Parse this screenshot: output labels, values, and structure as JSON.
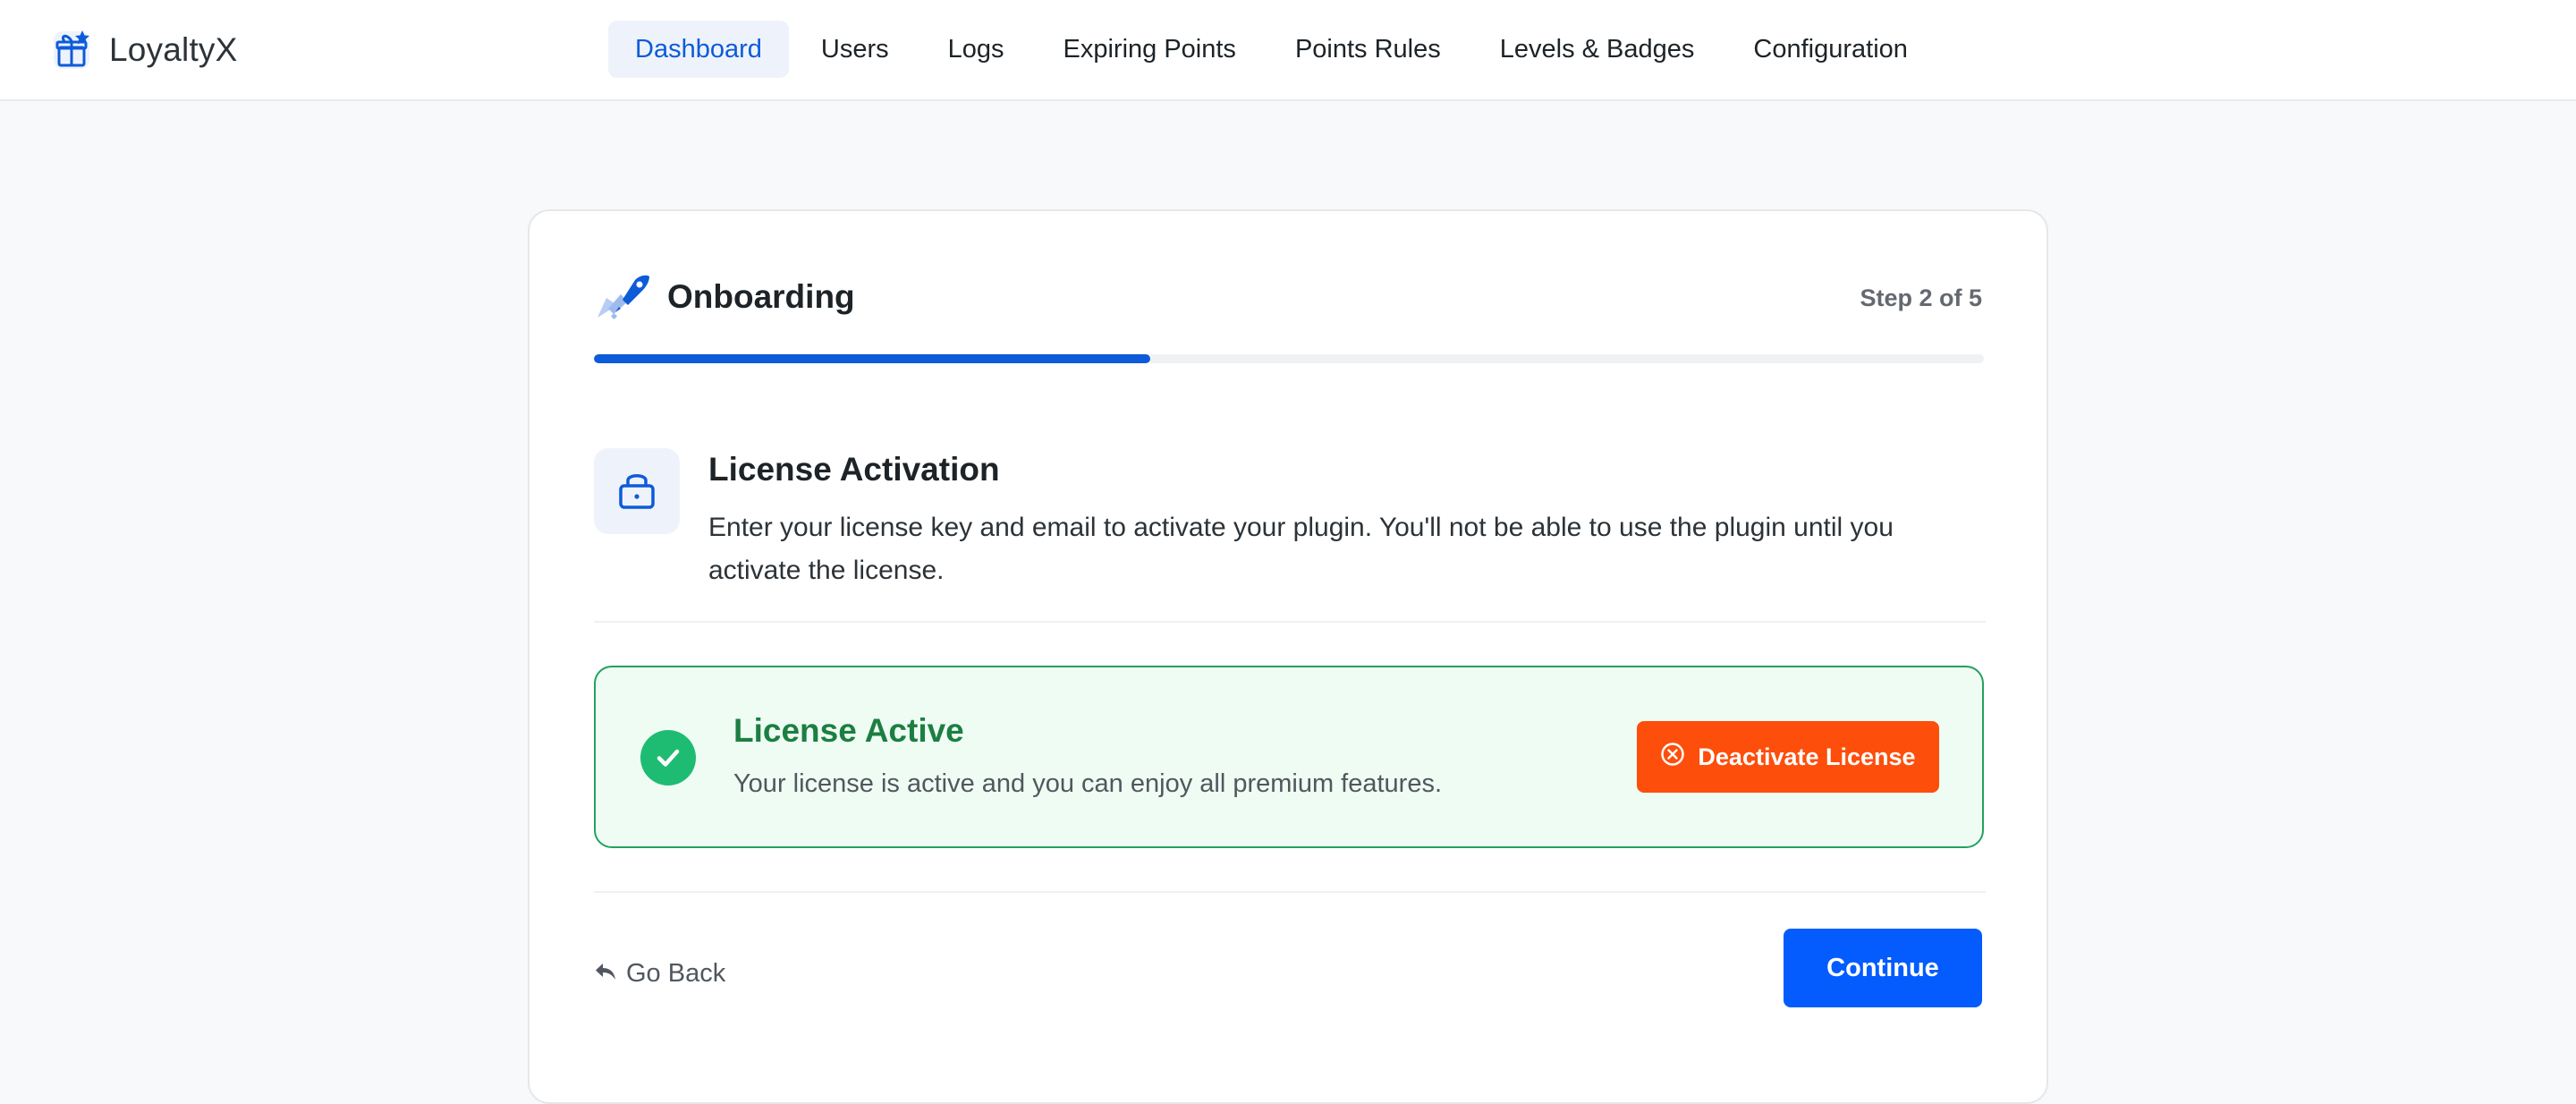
{
  "app": {
    "name": "LoyaltyX",
    "logo_icon": "gift-icon"
  },
  "nav": {
    "items": [
      {
        "label": "Dashboard",
        "active": true
      },
      {
        "label": "Users",
        "active": false
      },
      {
        "label": "Logs",
        "active": false
      },
      {
        "label": "Expiring Points",
        "active": false
      },
      {
        "label": "Points Rules",
        "active": false
      },
      {
        "label": "Levels & Badges",
        "active": false
      },
      {
        "label": "Configuration",
        "active": false
      }
    ]
  },
  "onboarding": {
    "title": "Onboarding",
    "icon": "rocket-icon",
    "step_text": "Step 2 of 5",
    "progress": 0.4
  },
  "license": {
    "icon": "lock-icon",
    "title": "License Activation",
    "description": "Enter your license key and email to activate your plugin. You'll not be able to use the plugin until you activate the license."
  },
  "status": {
    "icon": "check-circle-icon",
    "title": "License Active",
    "description": "Your license is active and you can enjoy all premium features.",
    "deactivate_label": "Deactivate License",
    "deactivate_icon": "x-circle-icon"
  },
  "footer": {
    "back_label": "Go Back",
    "back_icon": "reply-arrow-icon",
    "continue_label": "Continue"
  },
  "colors": {
    "accent": "#0d5bd9",
    "primary_button": "#045cff",
    "danger_button": "#fe4e0b",
    "success": "#1ebc72",
    "success_text": "#1c7f42",
    "success_bg": "#effcf3"
  }
}
